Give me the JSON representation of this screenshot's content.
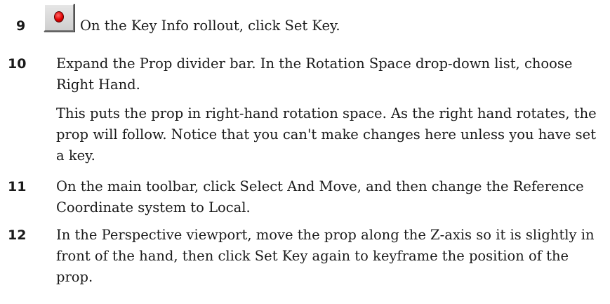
{
  "steps": [
    {
      "number": "9",
      "icon": "set-key-icon",
      "icon_color": "#e00000",
      "text": "On the Key Info rollout, click Set Key."
    },
    {
      "number": "10",
      "text": "Expand the Prop divider bar. In the Rotation Space drop-down list, choose Right Hand.",
      "note": "This puts the prop in right-hand rotation space. As the right hand rotates, the prop will follow. Notice that you can't make changes here unless you have set a key."
    },
    {
      "number": "11",
      "text": "On the main toolbar, click Select And Move, and then change the Reference Coordinate system to Local."
    },
    {
      "number": "12",
      "text": "In the Perspective viewport, move the prop along the Z-axis so it is slightly in front of the hand, then click Set Key again to keyframe the position of the prop."
    }
  ]
}
